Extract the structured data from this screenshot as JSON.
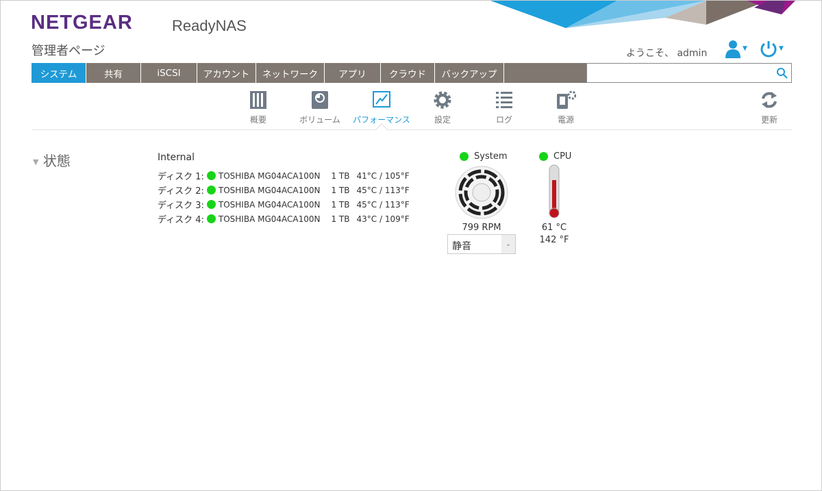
{
  "header": {
    "brand": "NETGEAR",
    "product": "ReadyNAS",
    "subtitle": "管理者ページ",
    "welcome": "ようこそ、 admin"
  },
  "nav": {
    "tabs": [
      "システム",
      "共有",
      "iSCSI",
      "アカウント",
      "ネットワーク",
      "アプリ",
      "クラウド",
      "バックアップ"
    ],
    "active": 0
  },
  "subnav": [
    {
      "label": "概要",
      "icon": "overview-icon"
    },
    {
      "label": "ボリューム",
      "icon": "volume-icon"
    },
    {
      "label": "パフォーマンス",
      "icon": "performance-icon"
    },
    {
      "label": "設定",
      "icon": "gear-icon"
    },
    {
      "label": "ログ",
      "icon": "list-icon"
    },
    {
      "label": "電源",
      "icon": "power-settings-icon"
    }
  ],
  "refresh_label": "更新",
  "status": {
    "title": "状態",
    "group": "Internal",
    "disks": [
      {
        "label": "ディスク 1:",
        "model": "TOSHIBA MG04ACA100N",
        "size": "1 TB",
        "temp": "41°C / 105°F"
      },
      {
        "label": "ディスク 2:",
        "model": "TOSHIBA MG04ACA100N",
        "size": "1 TB",
        "temp": "45°C / 113°F"
      },
      {
        "label": "ディスク 3:",
        "model": "TOSHIBA MG04ACA100N",
        "size": "1 TB",
        "temp": "45°C / 113°F"
      },
      {
        "label": "ディスク 4:",
        "model": "TOSHIBA MG04ACA100N",
        "size": "1 TB",
        "temp": "43°C / 109°F"
      }
    ],
    "system": {
      "label": "System",
      "rpm": "799 RPM",
      "fan_mode": "静音"
    },
    "cpu": {
      "label": "CPU",
      "temp_c": "61 °C",
      "temp_f": "142 °F"
    }
  },
  "colors": {
    "accent": "#1f9ad6",
    "nav": "#807870",
    "brand": "#5a2d82",
    "ok": "#18d418"
  }
}
